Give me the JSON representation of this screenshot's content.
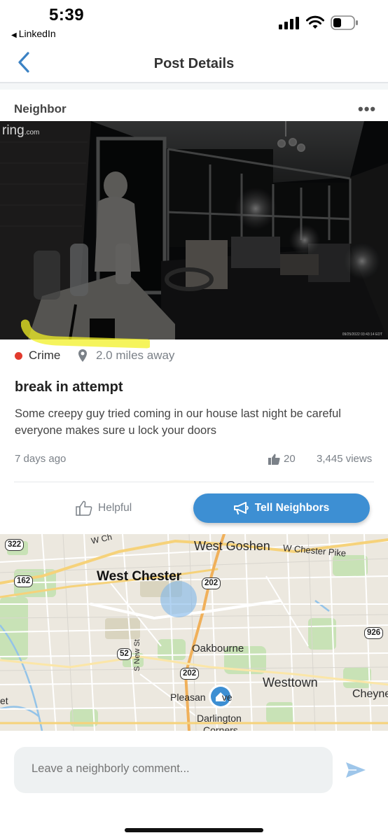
{
  "status_bar": {
    "time": "5:39",
    "back_app": "LinkedIn"
  },
  "nav": {
    "title": "Post Details"
  },
  "post": {
    "author": "Neighbor",
    "more_label": "•••",
    "image": {
      "logo": "ring",
      "logo_suffix": ".com",
      "timestamp": "09/25/2022 03:43:14 EDT"
    },
    "category": "Crime",
    "category_color": "#e23b2e",
    "distance": "2.0 miles away",
    "title": "break in attempt",
    "body": "Some creepy guy tried coming in our house last night be careful everyone makes sure u lock your doors",
    "date": "7 days ago",
    "likes": "20",
    "views": "3,445 views"
  },
  "actions": {
    "helpful_label": "Helpful",
    "tell_label": "Tell Neighbors",
    "tell_color": "#3d8fd3"
  },
  "map": {
    "labels": {
      "west_goshen": "West Goshen",
      "w_chester_pike": "W Chester Pike",
      "west_chester": "West Chester",
      "oakbourne": "Oakbourne",
      "westtown": "Westtown",
      "cheyney": "Cheyne",
      "pleasant_grove": "Pleasan      ve",
      "darlington": "Darlington",
      "corners": "Corners",
      "s_new_st": "S New St",
      "et": "et",
      "w_ch": "W Ch"
    },
    "shields": {
      "r322": "322",
      "r162": "162",
      "r202a": "202",
      "r52": "52",
      "r202b": "202",
      "r926": "926"
    }
  },
  "comment": {
    "placeholder": "Leave a neighborly comment..."
  }
}
